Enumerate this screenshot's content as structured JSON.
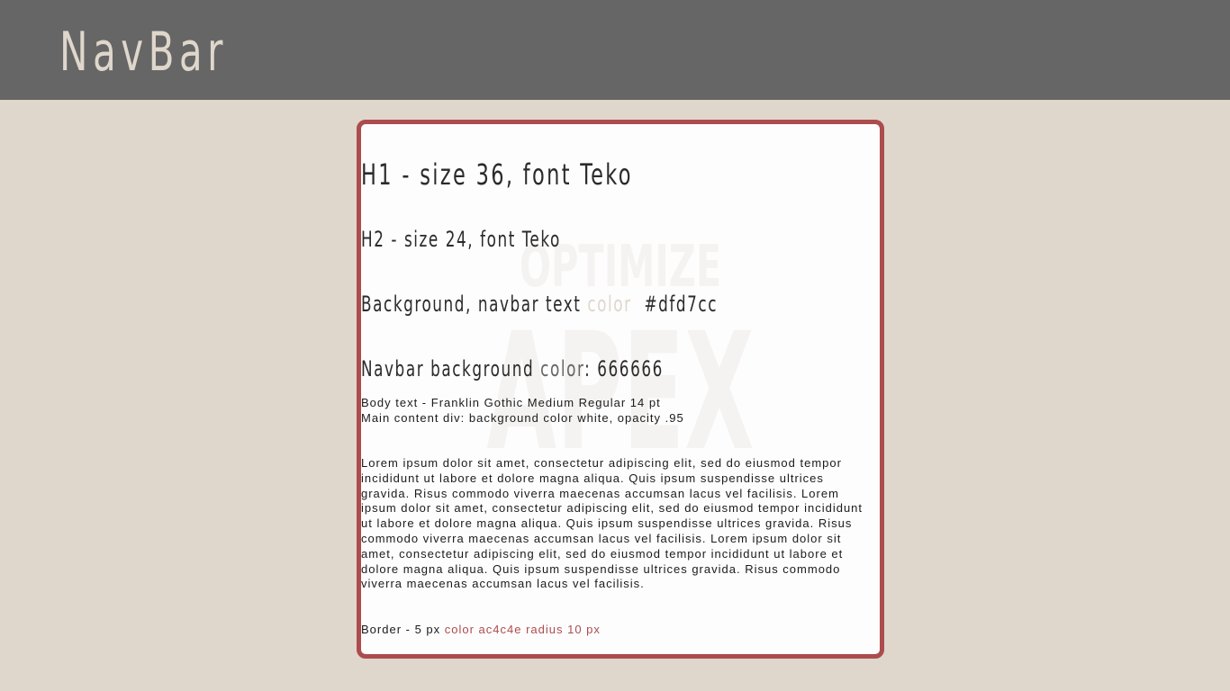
{
  "navbar": {
    "title": "NavBar"
  },
  "watermark": {
    "line1": "OPTIMIZE",
    "line2": "APEX"
  },
  "main": {
    "h1": "H1 - size 36, font Teko",
    "h2": "H2 - size 24, font Teko",
    "bg_line": {
      "prefix": "Background, navbar text ",
      "color_word": "color",
      "value": "  #dfd7cc"
    },
    "navbar_bg_line": {
      "prefix": "Navbar background ",
      "color_word": "color",
      "value": ": 666666"
    },
    "body_note_1": "Body text - Franklin Gothic Medium Regular 14 pt",
    "body_note_2": "Main content div: background color white, opacity .95",
    "lorem": "Lorem ipsum dolor sit amet, consectetur adipiscing elit, sed do eiusmod tempor incididunt ut labore et dolore magna aliqua. Quis ipsum suspendisse ultrices gravida. Risus commodo viverra maecenas accumsan lacus vel facilisis. Lorem ipsum dolor sit amet, consectetur adipiscing elit, sed do eiusmod tempor incididunt ut labore et dolore magna aliqua. Quis ipsum suspendisse ultrices gravida. Risus commodo viverra maecenas accumsan lacus vel facilisis.  Lorem ipsum dolor sit amet, consectetur adipiscing elit, sed do eiusmod tempor incididunt ut labore et dolore magna aliqua. Quis ipsum suspendisse ultrices gravida. Risus commodo viverra maecenas accumsan lacus vel facilisis.",
    "border_line": {
      "prefix": "Border - 5 px ",
      "red_text": "color ac4c4e radius 10 px"
    }
  },
  "colors": {
    "page_bg": "#dfd7cc",
    "navbar_bg": "#666666",
    "border": "#ac4c4e",
    "text": "#2b2b2b"
  }
}
